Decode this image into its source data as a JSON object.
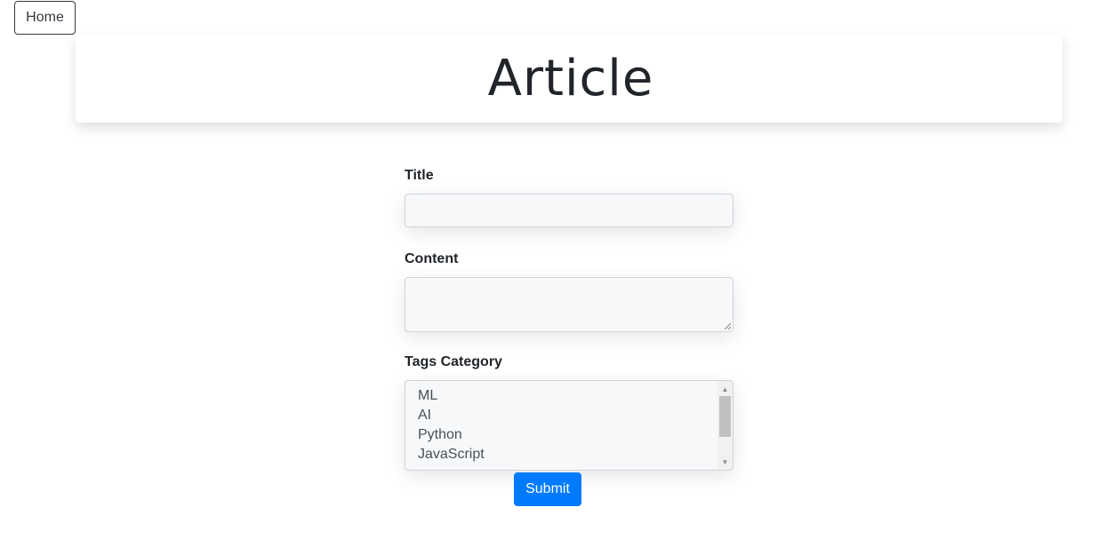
{
  "nav": {
    "home_label": "Home"
  },
  "header": {
    "title": "Article"
  },
  "form": {
    "title_label": "Title",
    "content_label": "Content",
    "tags_label": "Tags Category",
    "tags_options": [
      "ML",
      "AI",
      "Python",
      "JavaScript"
    ],
    "submit_label": "Submit"
  },
  "colors": {
    "primary": "#007bff",
    "input_background": "#f7f8fa",
    "border": "#ced4da",
    "text": "#212529"
  }
}
